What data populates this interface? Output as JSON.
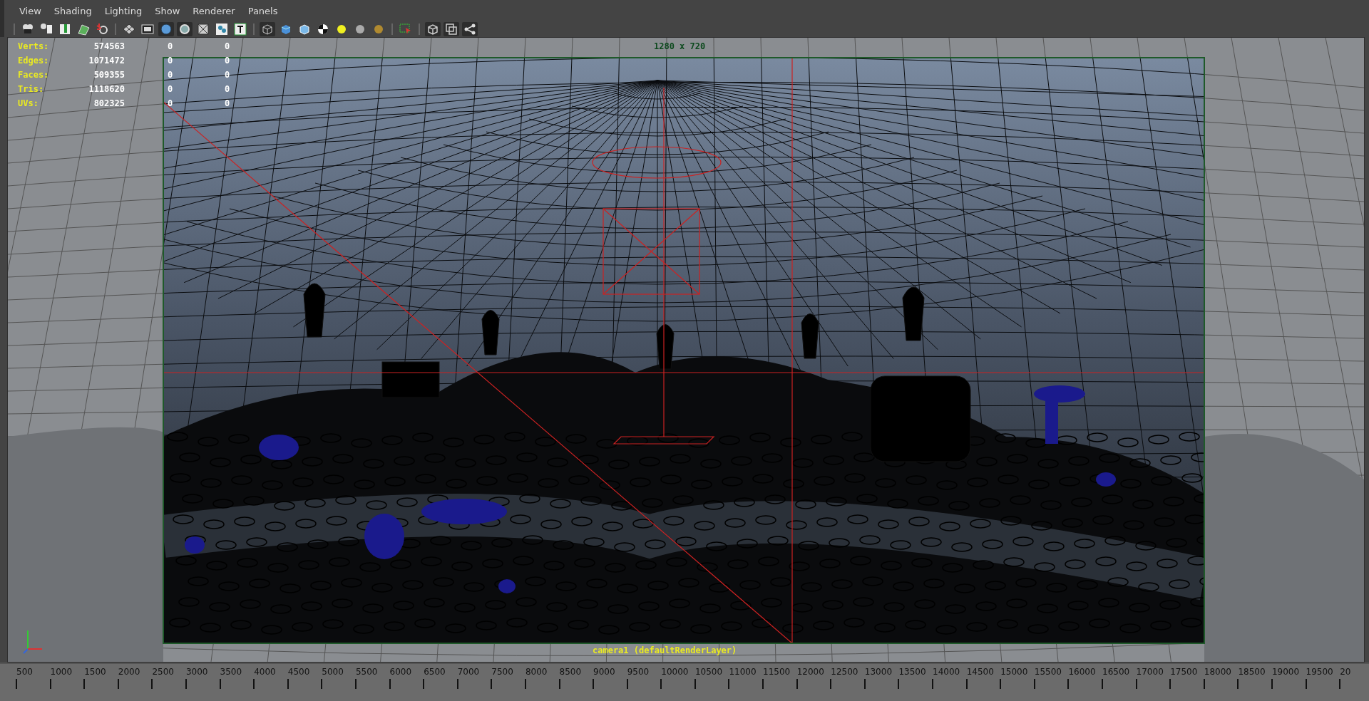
{
  "menu": [
    "View",
    "Shading",
    "Lighting",
    "Show",
    "Renderer",
    "Panels"
  ],
  "hud": [
    {
      "label": "Verts:",
      "value": "574563",
      "selected_count": "0",
      "component_count": "0"
    },
    {
      "label": "Edges:",
      "value": "1071472",
      "selected_count": "0",
      "component_count": "0"
    },
    {
      "label": "Faces:",
      "value": "509355",
      "selected_count": "0",
      "component_count": "0"
    },
    {
      "label": "Tris:",
      "value": "1118620",
      "selected_count": "0",
      "component_count": "0"
    },
    {
      "label": "UVs:",
      "value": "802325",
      "selected_count": "0",
      "component_count": "0"
    }
  ],
  "resolution": "1280 x 720",
  "camera_label": "camera1 (defaultRenderLayer)",
  "timeline": [
    "500",
    "1000",
    "1500",
    "2000",
    "2500",
    "3000",
    "3500",
    "4000",
    "4500",
    "5000",
    "5500",
    "6000",
    "6500",
    "7000",
    "7500",
    "8000",
    "8500",
    "9000",
    "9500",
    "10000",
    "10500",
    "11000",
    "11500",
    "12000",
    "12500",
    "13000",
    "13500",
    "14000",
    "14500",
    "15000",
    "15500",
    "16000",
    "16500",
    "17000",
    "17500",
    "18000",
    "18500",
    "19000",
    "19500",
    "20"
  ]
}
